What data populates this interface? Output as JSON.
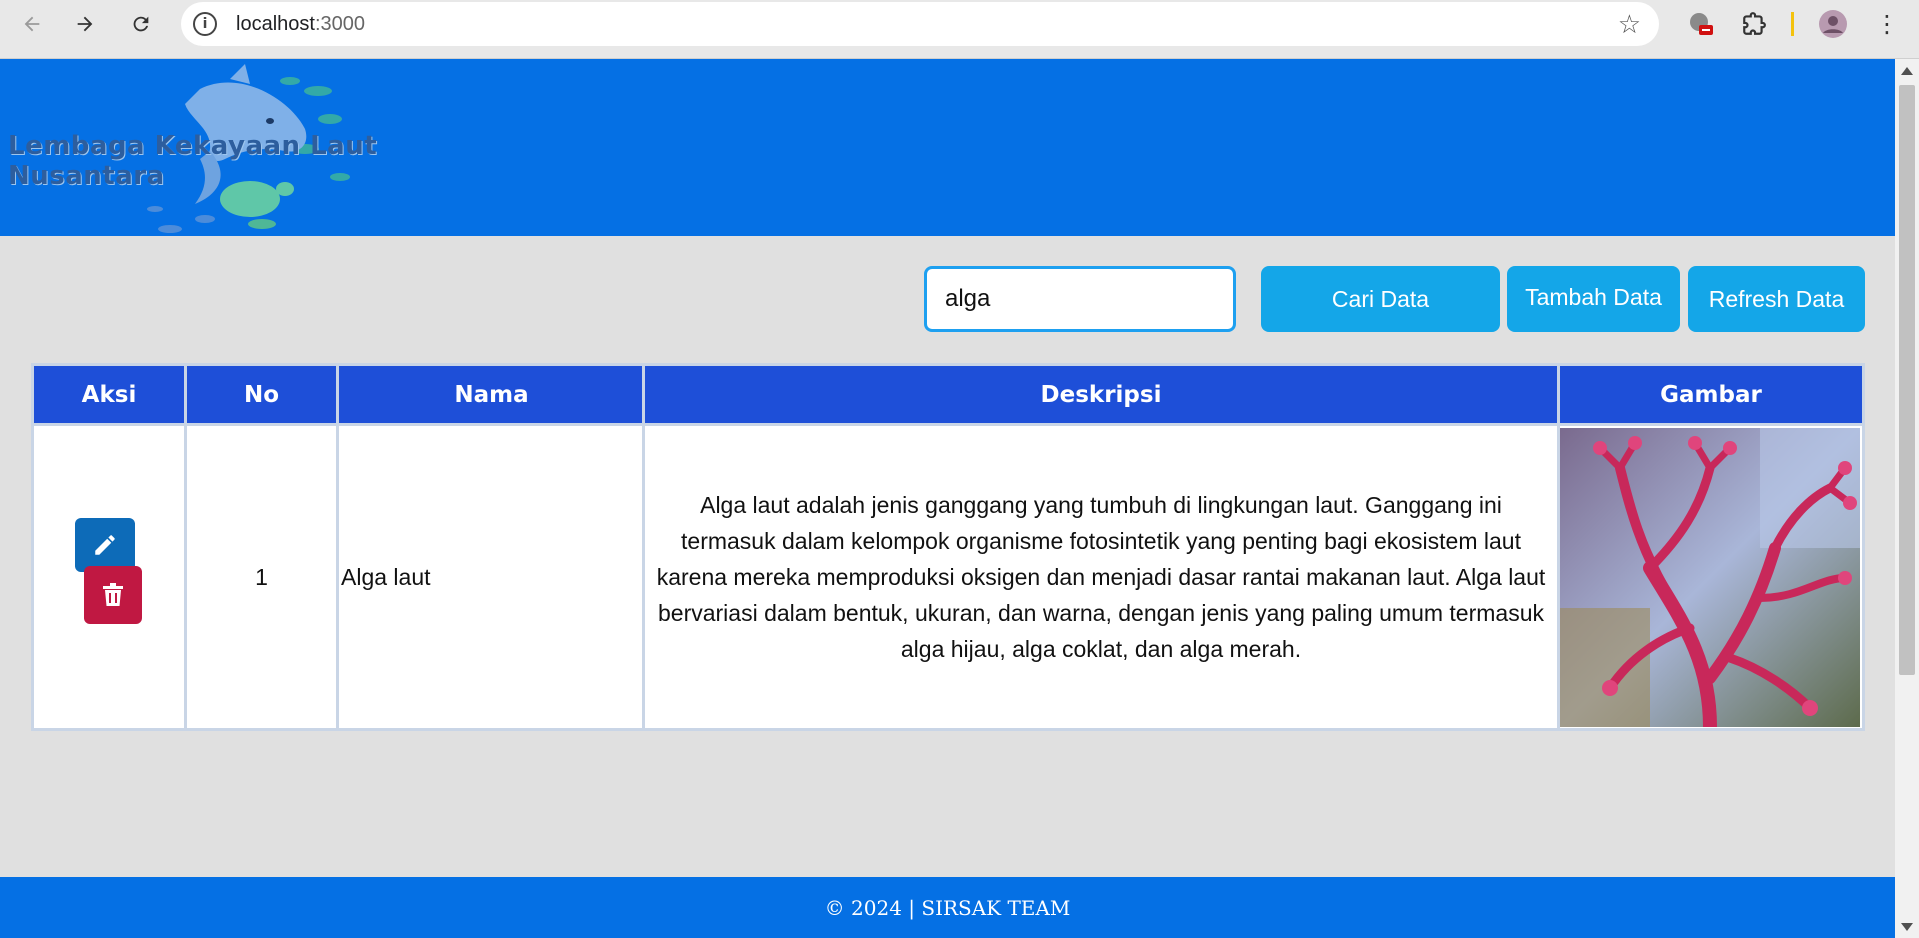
{
  "browser": {
    "url_host": "localhost",
    "url_port": ":3000"
  },
  "header": {
    "title": "Lembaga Kekayaan Laut Nusantara"
  },
  "controls": {
    "search_value": "alga",
    "search_button": "Cari Data",
    "add_button": "Tambah Data",
    "refresh_button": "Refresh Data"
  },
  "table": {
    "headers": [
      "Aksi",
      "No",
      "Nama",
      "Deskripsi",
      "Gambar"
    ],
    "rows": [
      {
        "no": "1",
        "nama": "Alga laut",
        "deskripsi": "Alga laut adalah jenis ganggang yang tumbuh di lingkungan laut. Ganggang ini termasuk dalam kelompok organisme fotosintetik yang penting bagi ekosistem laut karena mereka memproduksi oksigen dan menjadi dasar rantai makanan laut. Alga laut bervariasi dalam bentuk, ukuran, dan warna, dengan jenis yang paling umum termasuk alga hijau, alga coklat, dan alga merah.",
        "image_icon": "red-seaweed-photo"
      }
    ]
  },
  "footer": {
    "text": "© 2024 | SIRSAK TEAM"
  },
  "colors": {
    "header_bg": "#0570e4",
    "table_header_bg": "#1e4fd8",
    "button_bg": "#14a6e8",
    "edit_bg": "#0d6bb8",
    "delete_bg": "#c01842"
  }
}
